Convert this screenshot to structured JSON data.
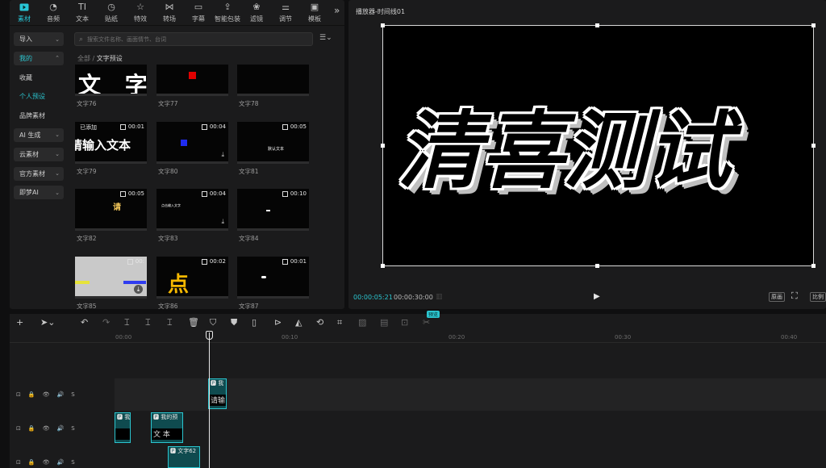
{
  "toolbar": {
    "tabs": [
      {
        "label": "素材",
        "icon": "media-icon"
      },
      {
        "label": "音频",
        "icon": "audio-icon"
      },
      {
        "label": "文本",
        "icon": "text-icon"
      },
      {
        "label": "贴纸",
        "icon": "sticker-icon"
      },
      {
        "label": "特效",
        "icon": "effects-icon"
      },
      {
        "label": "转场",
        "icon": "transition-icon"
      },
      {
        "label": "字幕",
        "icon": "subtitle-icon"
      },
      {
        "label": "智能包装",
        "icon": "smart-package-icon"
      },
      {
        "label": "滤镜",
        "icon": "filter-icon"
      },
      {
        "label": "调节",
        "icon": "adjust-icon"
      },
      {
        "label": "模板",
        "icon": "template-icon"
      }
    ],
    "more": "»"
  },
  "sidenav": {
    "items": [
      {
        "label": "导入",
        "chev": "⌄"
      },
      {
        "label": "我的",
        "chev": "⌃"
      },
      {
        "label": "收藏",
        "chev": ""
      },
      {
        "label": "个人预设",
        "chev": ""
      },
      {
        "label": "品牌素材",
        "chev": ""
      },
      {
        "label": "AI 生成",
        "chev": "⌄"
      },
      {
        "label": "云素材",
        "chev": "⌄"
      },
      {
        "label": "官方素材",
        "chev": "⌄"
      },
      {
        "label": "即梦AI",
        "chev": "⌄"
      }
    ]
  },
  "search": {
    "placeholder": "搜索文件名称、画面情节、台词"
  },
  "breadcrumb": {
    "root": "全部",
    "sep": "/",
    "current": "文字预设"
  },
  "presets": [
    {
      "name": "文字76",
      "thumb": "文 字",
      "duration": "",
      "added": ""
    },
    {
      "name": "文字77",
      "thumb": "",
      "duration": "",
      "added": ""
    },
    {
      "name": "文字78",
      "thumb": "",
      "duration": "",
      "added": ""
    },
    {
      "name": "文字79",
      "thumb": "请输入文本",
      "duration": "00:01",
      "added": "已添加"
    },
    {
      "name": "文字80",
      "thumb": "",
      "duration": "00:04",
      "added": ""
    },
    {
      "name": "文字81",
      "thumb": "默认文本",
      "duration": "00:05",
      "added": ""
    },
    {
      "name": "文字82",
      "thumb": "请",
      "duration": "00:05",
      "added": ""
    },
    {
      "name": "文字83",
      "thumb": "点击输入文字",
      "duration": "00:04",
      "added": ""
    },
    {
      "name": "文字84",
      "thumb": "",
      "duration": "00:10",
      "added": ""
    },
    {
      "name": "文字85",
      "thumb": "",
      "duration": "00:",
      "added": ""
    },
    {
      "name": "文字86",
      "thumb": "点",
      "duration": "00:02",
      "added": ""
    },
    {
      "name": "文字87",
      "thumb": "",
      "duration": "00:01",
      "added": ""
    }
  ],
  "player": {
    "title": "播放器-时间线01",
    "canvas_text": "清喜测试",
    "current_time": "00:00:05:21",
    "total_time": "00:00:30:00",
    "btn_original": "原画",
    "btn_ratio": "比例"
  },
  "timeline": {
    "ticks": [
      "00:00",
      "00:10",
      "00:20",
      "00:30",
      "00:40"
    ],
    "hint_badge": "预览",
    "track_ctrls": [
      "⊡",
      "🔒",
      "👁",
      "🔊",
      "S"
    ],
    "clips": [
      {
        "label": "🅿 我",
        "thumb": "请输"
      },
      {
        "label": "🅿 我",
        "thumb": ""
      },
      {
        "label": "🅿 我的预",
        "thumb": "文 本"
      },
      {
        "label": "🅿 文字62",
        "thumb": ""
      }
    ]
  },
  "colors": {
    "accent": "#2bc5cf",
    "panel": "#1b1b1c",
    "bg": "#0f0f10"
  }
}
